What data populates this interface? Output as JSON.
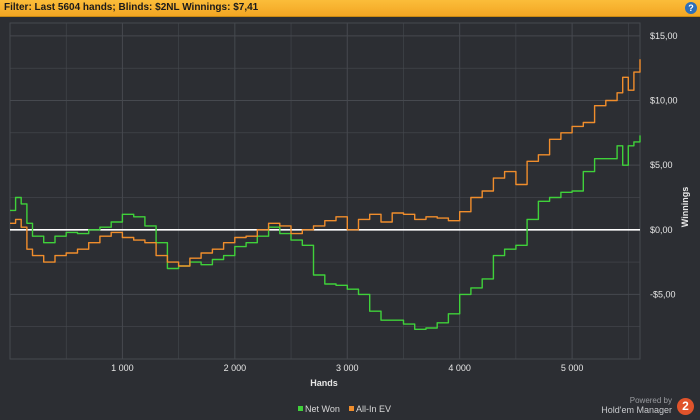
{
  "filter_bar": {
    "text": "Filter: Last 5604 hands; Blinds: $2NL Winnings: $7,41",
    "help_label": "?"
  },
  "branding": {
    "powered": "Powered by",
    "name": "Hold'em Manager",
    "badge": "2"
  },
  "colors": {
    "net_won": "#3fd13a",
    "all_in_ev": "#f08d2c",
    "zero_line": "#ffffff",
    "grid": "#46494f",
    "background": "#2c2e33"
  },
  "chart_data": {
    "type": "line",
    "xlabel": "Hands",
    "ylabel": "Winnings",
    "xlim": [
      0,
      5604
    ],
    "ylim": [
      -10,
      16
    ],
    "x_ticks": [
      1000,
      2000,
      3000,
      4000,
      5000
    ],
    "x_tick_labels": [
      "1 000",
      "2 000",
      "3 000",
      "4 000",
      "5 000"
    ],
    "y_ticks": [
      15,
      10,
      5,
      0,
      -5
    ],
    "y_tick_labels": [
      "$15,00",
      "$10,00",
      "$5,00",
      "$0,00",
      "-$5,00"
    ],
    "grid": true,
    "legend_position": "bottom",
    "series": [
      {
        "name": "Net Won",
        "color": "#3fd13a",
        "x": [
          0,
          50,
          100,
          150,
          200,
          300,
          400,
          500,
          600,
          700,
          800,
          900,
          1000,
          1100,
          1200,
          1300,
          1400,
          1500,
          1600,
          1700,
          1800,
          1900,
          2000,
          2100,
          2200,
          2300,
          2400,
          2500,
          2600,
          2700,
          2800,
          2900,
          3000,
          3100,
          3200,
          3300,
          3400,
          3500,
          3600,
          3700,
          3800,
          3900,
          4000,
          4100,
          4200,
          4300,
          4400,
          4500,
          4600,
          4700,
          4800,
          4900,
          5000,
          5100,
          5200,
          5300,
          5400,
          5450,
          5500,
          5550,
          5604
        ],
        "y": [
          1.5,
          2.5,
          2.0,
          0.5,
          -0.5,
          -1.0,
          -0.5,
          -0.2,
          -0.3,
          0.0,
          0.2,
          0.6,
          1.2,
          1.0,
          0.3,
          -1.0,
          -3.0,
          -2.8,
          -2.5,
          -2.7,
          -2.3,
          -2.0,
          -1.3,
          -1.0,
          -0.5,
          0.2,
          -0.3,
          -0.8,
          -1.2,
          -3.5,
          -4.2,
          -4.3,
          -4.6,
          -5.0,
          -6.3,
          -7.0,
          -7.0,
          -7.3,
          -7.7,
          -7.6,
          -7.2,
          -6.5,
          -5.0,
          -4.5,
          -3.8,
          -2.0,
          -1.5,
          -1.2,
          0.8,
          2.2,
          2.5,
          2.9,
          3.0,
          4.5,
          5.5,
          5.5,
          6.5,
          5.0,
          6.5,
          6.8,
          7.3
        ]
      },
      {
        "name": "All-In EV",
        "color": "#f08d2c",
        "x": [
          0,
          50,
          100,
          150,
          200,
          300,
          400,
          500,
          600,
          700,
          800,
          900,
          1000,
          1100,
          1200,
          1300,
          1400,
          1500,
          1600,
          1700,
          1800,
          1900,
          2000,
          2100,
          2200,
          2300,
          2400,
          2500,
          2600,
          2700,
          2800,
          2900,
          3000,
          3100,
          3200,
          3300,
          3400,
          3500,
          3600,
          3700,
          3800,
          3900,
          4000,
          4100,
          4200,
          4300,
          4400,
          4500,
          4600,
          4700,
          4800,
          4900,
          5000,
          5100,
          5200,
          5300,
          5400,
          5450,
          5500,
          5550,
          5604
        ],
        "y": [
          0.5,
          0.8,
          0.2,
          -1.5,
          -2.0,
          -2.5,
          -2.0,
          -1.8,
          -1.5,
          -1.0,
          -0.5,
          -0.2,
          -0.6,
          -0.8,
          -1.0,
          -2.0,
          -2.5,
          -2.8,
          -2.2,
          -1.8,
          -1.5,
          -1.0,
          -0.6,
          -0.5,
          0.0,
          0.5,
          0.3,
          -0.3,
          0.0,
          0.3,
          0.7,
          1.0,
          0.0,
          0.8,
          1.2,
          0.6,
          1.3,
          1.2,
          0.8,
          1.0,
          0.9,
          0.7,
          1.4,
          2.5,
          3.0,
          4.0,
          4.5,
          3.5,
          5.3,
          5.8,
          7.0,
          7.5,
          8.0,
          8.3,
          9.6,
          10.0,
          10.6,
          11.8,
          10.8,
          12.2,
          13.2
        ]
      }
    ]
  }
}
